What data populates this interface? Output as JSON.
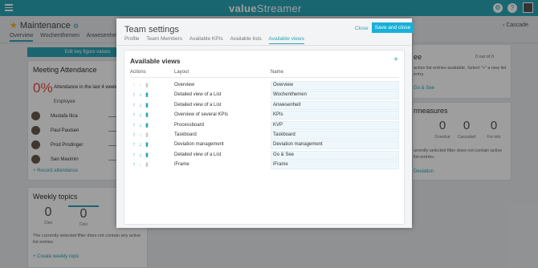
{
  "app": {
    "logo_bold": "value",
    "logo_rest": "Streamer",
    "topbar_icons": [
      "gear-icon",
      "help-icon"
    ]
  },
  "background": {
    "page_title": "Maintenance",
    "tabs": [
      "Overview",
      "Wochenthemen",
      "Anwesenheit"
    ],
    "edit_kpi_label": "Edit key figure values",
    "meeting_attendance": {
      "title": "Meeting Attendance",
      "percent": "0%",
      "text": "Attendance in the last 4 weeks",
      "employee_header": "Employee",
      "employees": [
        "Mustafa Ilica",
        "Paul Paulsen",
        "Prod Prodinger",
        "San Maximin"
      ],
      "record_link": "+ Record attendance"
    },
    "weekly_topics": {
      "title": "Weekly topics",
      "boxes": [
        {
          "value": "0",
          "label": "Cleo"
        },
        {
          "value": "0",
          "label": "Cleo"
        }
      ],
      "message": "The currently selected filter does not contain any active list entries.",
      "create_link": "+ Create weekly topic"
    },
    "right": {
      "nav_text": "Cascade",
      "pagination": "0 out of 0",
      "go_see_title": "ee",
      "go_see_text": "active list entries available. Select \"+\" a new list entry.",
      "go_see_link": "Go & See",
      "measures_title": "rmeasures",
      "measures": [
        {
          "value": "0",
          "label": "Overdue"
        },
        {
          "value": "0",
          "label": "Cascaded"
        },
        {
          "value": "0",
          "label": "For info"
        }
      ],
      "measures_msg": "urrently selected filter does not contain active list entries.",
      "deviation_link": "Deviation"
    }
  },
  "modal": {
    "title": "Team settings",
    "tabs": [
      "Profile",
      "Team Members",
      "Available KPIs",
      "Available lists",
      "Available views"
    ],
    "active_tab_index": 4,
    "close_label": "Close",
    "save_label": "Save and close",
    "panel": {
      "title": "Available views",
      "columns": {
        "actions": "Actions",
        "layout": "Layout",
        "name": "Name"
      },
      "rows": [
        {
          "layout": "Overview",
          "name": "Overview",
          "up": false,
          "down": false,
          "delete": false
        },
        {
          "layout": "Detailed view of a List",
          "name": "Wochenthemen",
          "up": true,
          "down": true,
          "delete": true
        },
        {
          "layout": "Detailed view of a List",
          "name": "Anwesenheit",
          "up": true,
          "down": true,
          "delete": true
        },
        {
          "layout": "Overview of several KPIs",
          "name": "KPIs",
          "up": true,
          "down": true,
          "delete": true
        },
        {
          "layout": "Processboard",
          "name": "KVP",
          "up": true,
          "down": true,
          "delete": true
        },
        {
          "layout": "Taskboard",
          "name": "Taskboard",
          "up": true,
          "down": false,
          "delete": false
        },
        {
          "layout": "Deviation management",
          "name": "Deviation management",
          "up": true,
          "down": true,
          "delete": true
        },
        {
          "layout": "Detailed view of a List",
          "name": "Go & See",
          "up": true,
          "down": true,
          "delete": true
        },
        {
          "layout": "iFrame",
          "name": "iFrame",
          "up": true,
          "down": false,
          "delete": false
        }
      ]
    }
  },
  "colors": {
    "accent": "#2aa5b5",
    "save_button": "#18b0d8",
    "danger": "#e74c3c",
    "disabled": "#c6ccd0"
  }
}
